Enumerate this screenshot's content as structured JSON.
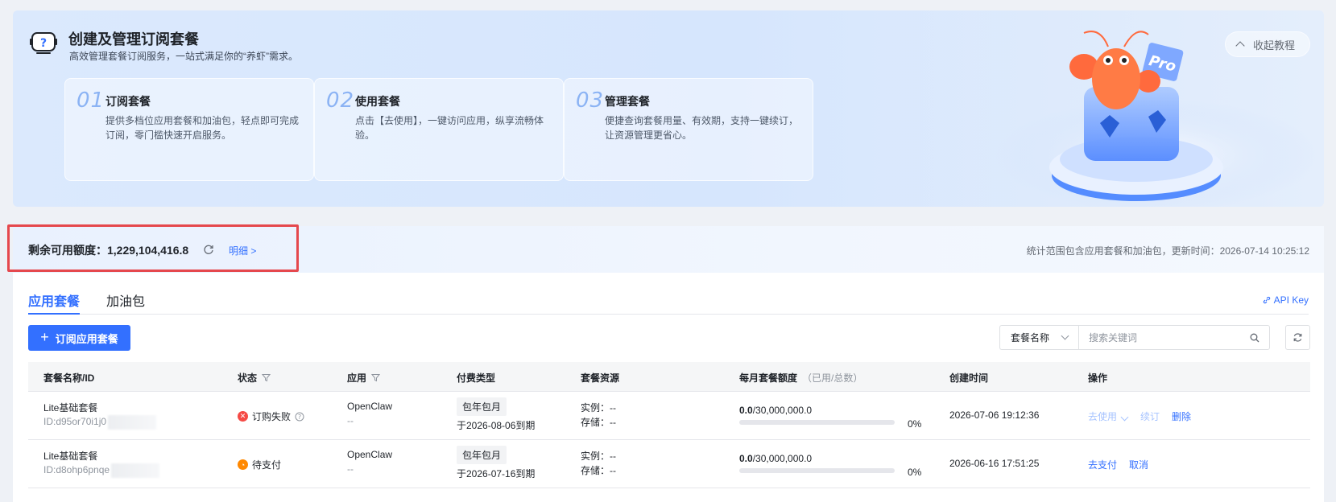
{
  "banner": {
    "title": "创建及管理订阅套餐",
    "subtitle": "高效管理套餐订阅服务，一站式满足你的“养虾”需求。",
    "collapse_label": "收起教程",
    "steps": [
      {
        "num": "01",
        "title": "订阅套餐",
        "desc": "提供多档位应用套餐和加油包，轻点即可完成订阅，零门槛快速开启服务。"
      },
      {
        "num": "02",
        "title": "使用套餐",
        "desc": "点击【去使用】，一键访问应用，纵享流畅体验。"
      },
      {
        "num": "03",
        "title": "管理套餐",
        "desc": "便捷查询套餐用量、有效期，支持一键续订，让资源管理更省心。"
      }
    ],
    "badge": "Pro"
  },
  "quota": {
    "label": "剩余可用额度：1,229,104,416.8",
    "detail_link": "明细 >",
    "note": "统计范围包含应用套餐和加油包，更新时间：2026-07-14 10:25:12"
  },
  "tabs": [
    {
      "label": "应用套餐",
      "active": true
    },
    {
      "label": "加油包",
      "active": false
    }
  ],
  "api_key_label": "API Key",
  "toolbar": {
    "subscribe_label": "订阅应用套餐",
    "filter_select": "套餐名称",
    "search_placeholder": "搜索关键词"
  },
  "table": {
    "headers": {
      "name": "套餐名称/ID",
      "status": "状态",
      "app": "应用",
      "pay_type": "付费类型",
      "resources": "套餐资源",
      "quota": "每月套餐额度",
      "quota_hint": "（已用/总数）",
      "created": "创建时间",
      "actions": "操作"
    },
    "rows": [
      {
        "name": "Lite基础套餐",
        "id": "ID:d95or70i1j0",
        "status": "订购失败",
        "status_color": "#f54a45",
        "app": "OpenClaw",
        "app_sub": "--",
        "pay_tag": "包年包月",
        "expire": "于2026-08-06到期",
        "instances": "实例：--",
        "storage": "存储：--",
        "used": "0.0",
        "total": "/30,000,000.0",
        "percent_label": "0%",
        "percent": 0,
        "created": "2026-07-06 19:12:36",
        "actions": [
          "去使用",
          "续订",
          "删除"
        ]
      },
      {
        "name": "Lite基础套餐",
        "id": "ID:d8ohp6pnqe",
        "status": "待支付",
        "status_color": "#ff8800",
        "app": "OpenClaw",
        "app_sub": "--",
        "pay_tag": "包年包月",
        "expire": "于2026-07-16到期",
        "instances": "实例：--",
        "storage": "存储：--",
        "used": "0.0",
        "total": "/30,000,000.0",
        "percent_label": "0%",
        "percent": 0,
        "created": "2026-06-16 17:51:25",
        "actions": [
          "去支付",
          "取消"
        ]
      }
    ]
  }
}
